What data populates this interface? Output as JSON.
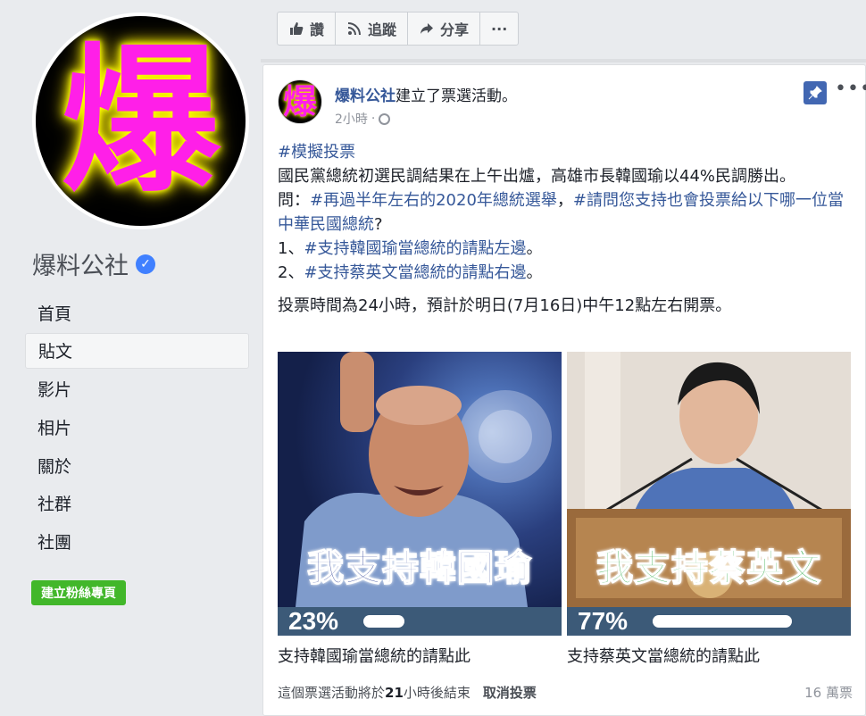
{
  "sidebar": {
    "avatar_char": "爆",
    "page_name": "爆料公社",
    "nav": [
      {
        "label": "首頁"
      },
      {
        "label": "貼文"
      },
      {
        "label": "影片"
      },
      {
        "label": "相片"
      },
      {
        "label": "關於"
      },
      {
        "label": "社群"
      },
      {
        "label": "社團"
      }
    ],
    "create_page_label": "建立粉絲專頁"
  },
  "action_bar": {
    "like_label": "讚",
    "follow_label": "追蹤",
    "share_label": "分享",
    "more_label": "···"
  },
  "post": {
    "avatar_char": "爆",
    "author": "爆料公社",
    "action": "建立了票選活動。",
    "time": "2小時",
    "dot": "·",
    "more": "•••",
    "body": {
      "line1_tag": "#模擬投票",
      "line2": "國民黨總統初選民調結果在上午出爐，高雄市長韓國瑜以44%民調勝出。",
      "line3_prefix": "問：",
      "line3_tag1": "#再過半年左右的2020年總統選舉",
      "line3_sep": "，",
      "line3_tag2": "#請問您支持也會投票給以下哪一位當中華民國總統",
      "line3_end": "?",
      "line4_prefix": "1、",
      "line4_tag": "#支持韓國瑜當總統的請點左邊",
      "line4_end": "。",
      "line5_prefix": "2、",
      "line5_tag": "#支持蔡英文當總統的請點右邊",
      "line5_end": "。",
      "line6": "投票時間為24小時，預計於明日(7月16日)中午12點左右開票。"
    },
    "poll": [
      {
        "overlay": "我支持韓國瑜",
        "percent_label": "23%",
        "percent": 23,
        "label": "支持韓國瑜當總統的請點此",
        "color": "#1a2f8c"
      },
      {
        "overlay": "我支持蔡英文",
        "percent_label": "77%",
        "percent": 77,
        "label": "支持蔡英文當總統的請點此",
        "color": "#22a53b"
      }
    ],
    "footer": {
      "ends_prefix": "這個票選活動將於",
      "ends_bold": "21",
      "ends_suffix": "小時後結束",
      "cancel": "取消投票",
      "votes": "16 萬票"
    }
  },
  "colors": {
    "link": "#365899",
    "green_button": "#42b72a",
    "poll_bar": "#3c5a78",
    "pin": "#4267b2"
  }
}
